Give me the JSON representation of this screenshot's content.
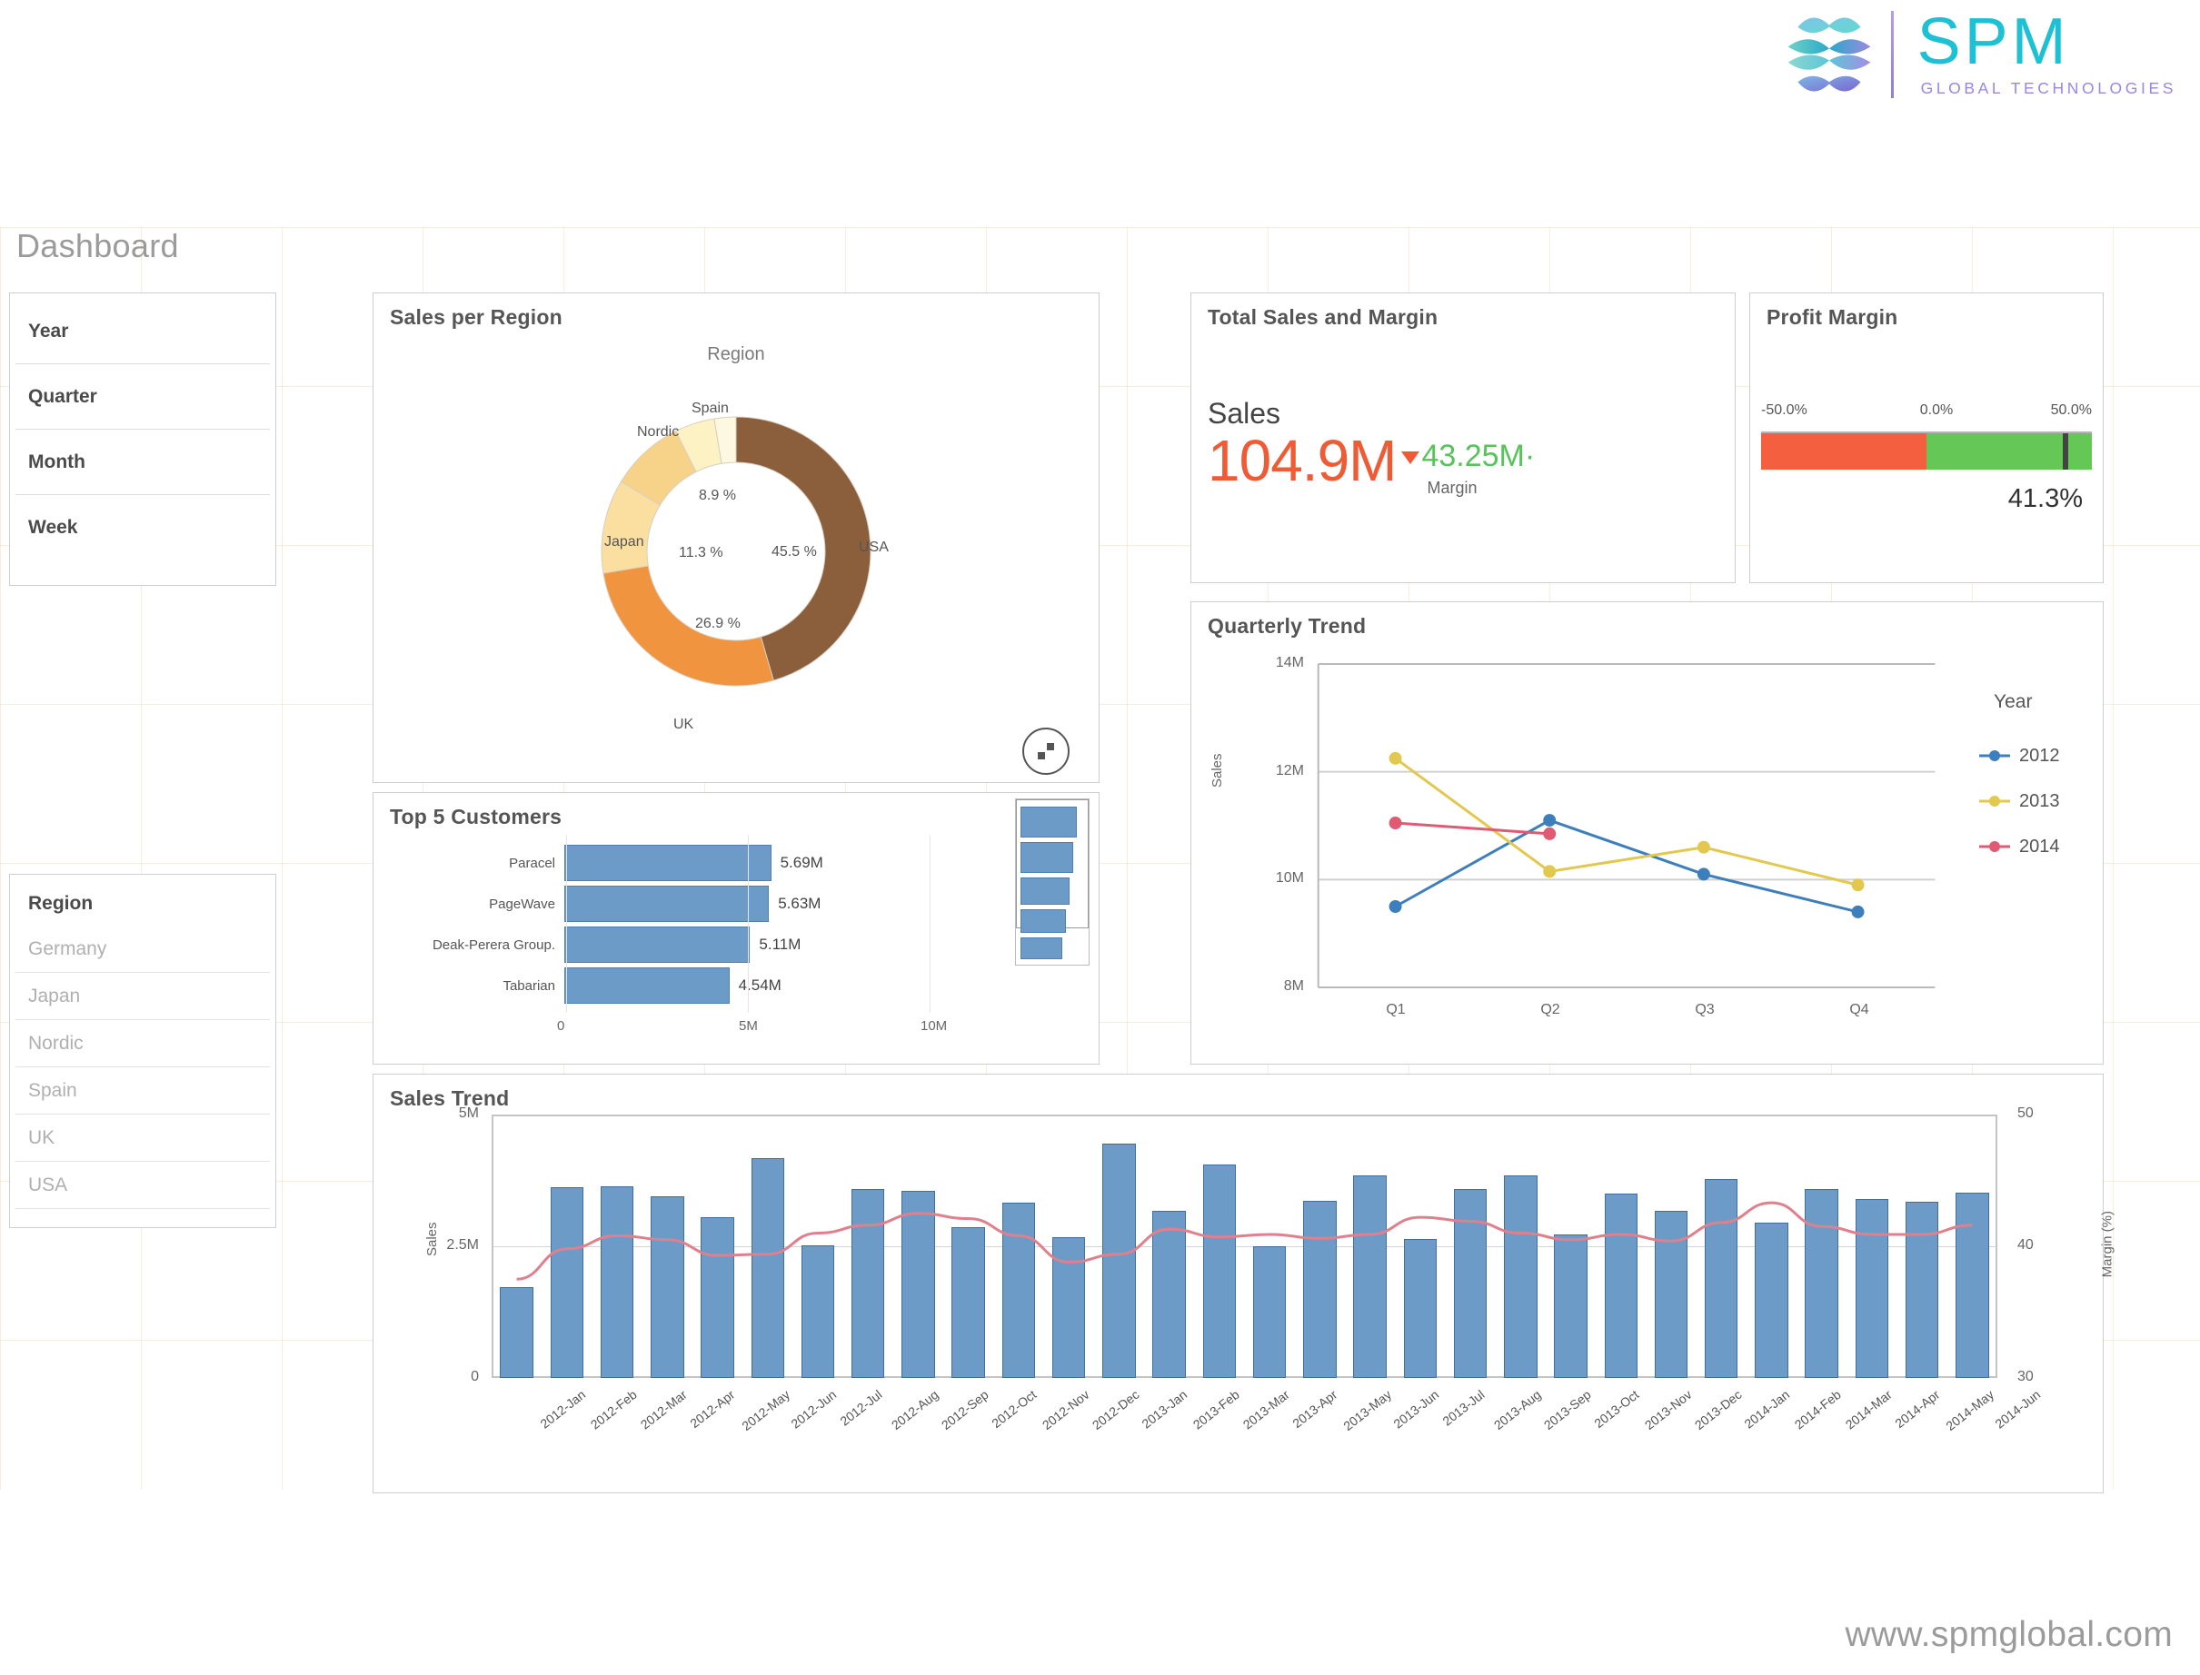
{
  "brand": {
    "name": "SPM",
    "tagline": "GLOBAL TECHNOLOGIES",
    "accent": "#1ec0d4",
    "tagline_color": "#9b86e0"
  },
  "page_title": "Dashboard",
  "footer": {
    "url": "www.spmglobal.com"
  },
  "filters": {
    "items": [
      {
        "label": "Year"
      },
      {
        "label": "Quarter"
      },
      {
        "label": "Month"
      },
      {
        "label": "Week"
      }
    ]
  },
  "region_filter": {
    "title": "Region",
    "items": [
      "Germany",
      "Japan",
      "Nordic",
      "Spain",
      "UK",
      "USA"
    ]
  },
  "kpi": {
    "title": "Total Sales and Margin",
    "measure_label": "Sales",
    "value": "104.9M",
    "value_color": "#ee5b35",
    "trend": "down",
    "secondary_value": "43.25M",
    "secondary_color": "#57c45a",
    "secondary_label": "Margin"
  },
  "profit_margin": {
    "title": "Profit Margin",
    "ticks": [
      "-50.0%",
      "0.0%",
      "50.0%"
    ],
    "value_label": "41.3%",
    "value": 41.3,
    "min": -50,
    "max": 50,
    "negative_color": "#f4603f",
    "positive_color": "#64c756"
  },
  "chart_data": [
    {
      "id": "sales_per_region",
      "type": "pie",
      "title": "Sales per Region",
      "legend_title": "Region",
      "labels": [
        "USA",
        "UK",
        "Japan",
        "Nordic",
        "Spain",
        "Germany"
      ],
      "percent_labels": [
        "45.5 %",
        "26.9 %",
        "11.3 %",
        "8.9 %",
        "",
        ""
      ],
      "values": [
        45.5,
        26.9,
        11.3,
        8.9,
        4.8,
        2.6
      ],
      "colors": [
        "#8b5e3c",
        "#f0943f",
        "#fbdfa0",
        "#f7d289",
        "#fdf2c4",
        "#fdf8e0"
      ],
      "legend": "labels-on-slices"
    },
    {
      "id": "top_5_customers",
      "type": "bar",
      "title": "Top 5 Customers",
      "orientation": "horizontal",
      "categories": [
        "Paracel",
        "PageWave",
        "Deak-Perera Group.",
        "Tabarian"
      ],
      "values": [
        5.69,
        5.63,
        5.11,
        4.54
      ],
      "value_labels": [
        "5.69M",
        "5.63M",
        "5.11M",
        "4.54M"
      ],
      "xticks": [
        "0",
        "5M",
        "10M"
      ],
      "xlim": [
        0,
        10
      ],
      "bar_color": "#6d9bc8"
    },
    {
      "id": "quarterly_trend",
      "type": "line",
      "title": "Quarterly Trend",
      "categories": [
        "Q1",
        "Q2",
        "Q3",
        "Q4"
      ],
      "ylabel": "Sales",
      "yticks": [
        "8M",
        "10M",
        "12M",
        "14M"
      ],
      "ylim": [
        8,
        14
      ],
      "legend_title": "Year",
      "legend_position": "right",
      "series": [
        {
          "name": "2012",
          "color": "#3d7ebd",
          "values": [
            9.5,
            11.1,
            10.1,
            9.4
          ]
        },
        {
          "name": "2013",
          "color": "#e3c84f",
          "values": [
            12.25,
            10.15,
            10.6,
            9.9
          ]
        },
        {
          "name": "2014",
          "color": "#e05a72",
          "values": [
            11.05,
            10.85,
            null,
            null
          ]
        }
      ]
    },
    {
      "id": "sales_trend",
      "type": "bar",
      "title": "Sales Trend",
      "ylabel": "Sales",
      "y2label": "Margin (%)",
      "yticks": [
        "0",
        "2.5M",
        "5M"
      ],
      "ylim": [
        0,
        5
      ],
      "y2ticks": [
        "30",
        "40",
        "50"
      ],
      "y2lim": [
        30,
        50
      ],
      "bar_color": "#6d9bc8",
      "line_color": "#e0808c",
      "categories": [
        "2012-Jan",
        "2012-Feb",
        "2012-Mar",
        "2012-Apr",
        "2012-May",
        "2012-Jun",
        "2012-Jul",
        "2012-Aug",
        "2012-Sep",
        "2012-Oct",
        "2012-Nov",
        "2012-Dec",
        "2013-Jan",
        "2013-Feb",
        "2013-Mar",
        "2013-Apr",
        "2013-May",
        "2013-Jun",
        "2013-Jul",
        "2013-Aug",
        "2013-Sep",
        "2013-Oct",
        "2013-Nov",
        "2013-Dec",
        "2014-Jan",
        "2014-Feb",
        "2014-Mar",
        "2014-Apr",
        "2014-May",
        "2014-Jun"
      ],
      "values": [
        1.72,
        3.62,
        3.64,
        3.44,
        3.05,
        4.18,
        2.52,
        3.58,
        3.55,
        2.87,
        3.33,
        2.67,
        4.45,
        3.17,
        4.06,
        2.5,
        3.36,
        3.84,
        2.64,
        3.58,
        3.84,
        2.73,
        3.5,
        3.18,
        3.78,
        2.95,
        3.58,
        3.4,
        3.35,
        3.52
      ],
      "margin_values": [
        37.5,
        39.8,
        40.8,
        40.5,
        39.3,
        39.4,
        41.0,
        41.6,
        42.5,
        42.1,
        40.8,
        38.8,
        39.4,
        41.3,
        40.7,
        40.9,
        40.6,
        40.9,
        42.2,
        41.9,
        41.0,
        40.5,
        40.9,
        40.4,
        41.8,
        43.3,
        41.5,
        40.9,
        40.9,
        41.6
      ]
    }
  ]
}
